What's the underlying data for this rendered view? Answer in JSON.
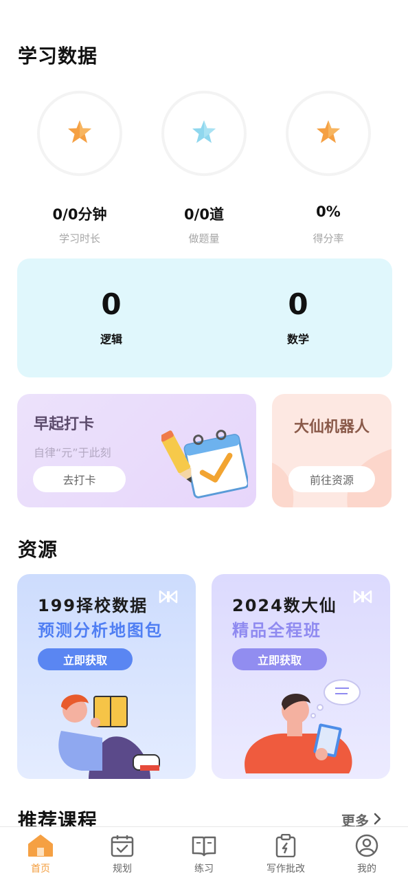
{
  "study": {
    "title": "学习数据",
    "stats": [
      {
        "value": "0/0分钟",
        "label": "学习时长",
        "icon": "star-orange-icon"
      },
      {
        "value": "0/0道",
        "label": "做题量",
        "icon": "star-blue-icon"
      },
      {
        "value": "0%",
        "label": "得分率",
        "icon": "star-orange-icon"
      }
    ]
  },
  "scores": [
    {
      "value": "0",
      "label": "逻辑"
    },
    {
      "value": "0",
      "label": "数学"
    }
  ],
  "checkin": {
    "title": "早起打卡",
    "subtitle": "自律“元”于此刻",
    "button": "去打卡"
  },
  "robot": {
    "title": "大仙机器人",
    "button": "前往资源"
  },
  "resources": {
    "title": "资源",
    "cards": [
      {
        "line1": "199择校数据",
        "line2": "预测分析地图包",
        "button": "立即获取",
        "accent": "#4f7ef3"
      },
      {
        "line1": "2024数大仙",
        "line2": "精品全程班",
        "button": "立即获取",
        "accent": "#8f8af0"
      }
    ]
  },
  "recommend": {
    "title": "推荐课程",
    "more": "更多"
  },
  "tabbar": {
    "items": [
      {
        "label": "首页",
        "icon": "home-icon",
        "active": true
      },
      {
        "label": "规划",
        "icon": "calendar-check-icon"
      },
      {
        "label": "练习",
        "icon": "book-icon"
      },
      {
        "label": "写作批改",
        "icon": "clipboard-edit-icon"
      },
      {
        "label": "我的",
        "icon": "user-circle-icon"
      }
    ]
  },
  "colors": {
    "accent": "#f39c3c",
    "score_bg": "#e0f7fc",
    "star_orange": "#f5a043",
    "star_blue": "#8fd7ee"
  }
}
